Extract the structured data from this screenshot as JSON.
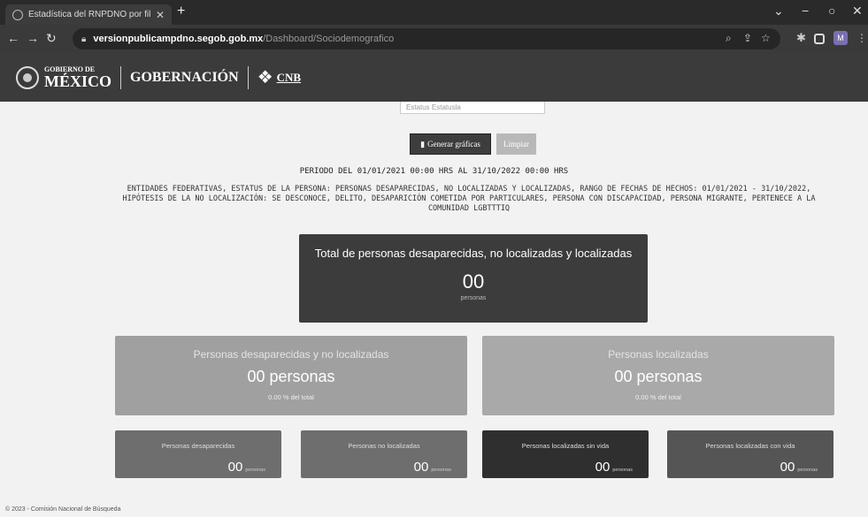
{
  "browser": {
    "tab_title": "Estadística del RNPDNO por filt",
    "tab_close": "✕",
    "new_tab": "+",
    "url_host": "versionpublicampdno.segob.gob.mx",
    "url_path": "/Dashboard/Sociodemografico",
    "profile_initial": "M"
  },
  "header": {
    "gob_small": "GOBIERNO DE",
    "gob_big": "MÉXICO",
    "gobernacion": "GOBERNACIÓN",
    "cnb": "CNB"
  },
  "form": {
    "state_placeholder": "Estatus Estatusla",
    "generate_label": "Generar gráficas",
    "clear_label": "Limpiar"
  },
  "summary": {
    "period": "PERIODO DEL 01/01/2021 00:00 HRS AL 31/10/2022 00:00 HRS",
    "filters": "ENTIDADES FEDERATIVAS, ESTATUS DE LA PERSONA: PERSONAS DESAPARECIDAS, NO LOCALIZADAS Y LOCALIZADAS, RANGO DE FECHAS DE HECHOS: 01/01/2021 - 31/10/2022, HIPÓTESIS DE LA NO LOCALIZACIÓN: SE DESCONOCE, DELITO, DESAPARICIÓN COMETIDA POR PARTICULARES, PERSONA CON DISCAPACIDAD, PERSONA MIGRANTE, PERTENECE A LA COMUNIDAD LGBTTTIQ"
  },
  "total": {
    "label": "Total de personas desaparecidas, no localizadas y localizadas",
    "value": "00",
    "unit": "personas"
  },
  "missing": {
    "label": "Personas desaparecidas y no localizadas",
    "value": "00 personas",
    "percent": "0.00 % del total"
  },
  "located": {
    "label": "Personas localizadas",
    "value": "00 personas",
    "percent": "0.00 % del total"
  },
  "small_cards": [
    {
      "label": "Personas desaparecidas",
      "value": "00",
      "unit": "personas"
    },
    {
      "label": "Personas no localizadas",
      "value": "00",
      "unit": "personas"
    },
    {
      "label": "Personas localizadas sin vida",
      "value": "00",
      "unit": "personas"
    },
    {
      "label": "Personas localizadas con vida",
      "value": "00",
      "unit": "personas"
    }
  ],
  "footer": "© 2023 - Comisión Nacional de Búsqueda"
}
